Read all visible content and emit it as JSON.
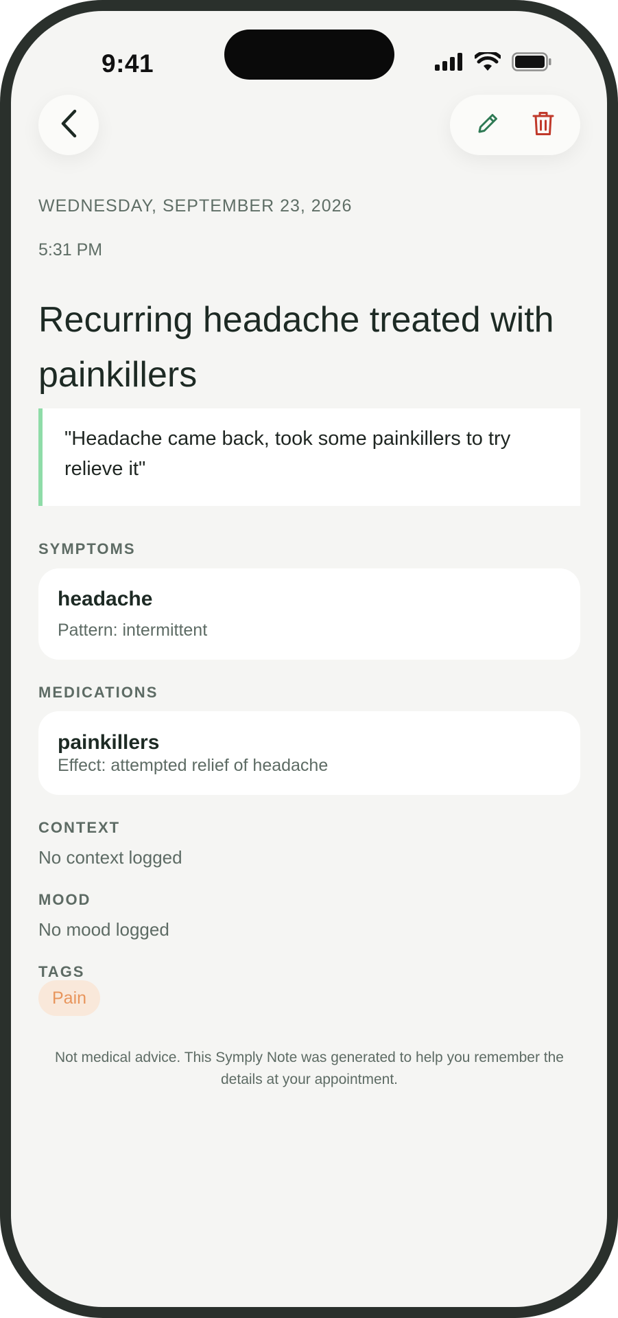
{
  "status_bar": {
    "time": "9:41"
  },
  "colors": {
    "accent_green": "#8fdca8",
    "edit_icon": "#2f7a55",
    "delete_icon": "#c0392b",
    "tag_bg": "#f9e8da",
    "tag_text": "#e8955c"
  },
  "header": {
    "back_icon": "chevron-left-icon",
    "edit_icon": "pencil-icon",
    "delete_icon": "trash-icon"
  },
  "entry": {
    "date": "WEDNESDAY, SEPTEMBER 23, 2026",
    "time": "5:31 PM",
    "title": "Recurring headache treated with painkillers",
    "quote": "\"Headache came back, took some painkillers to try relieve it\""
  },
  "symptoms": {
    "label": "SYMPTOMS",
    "items": [
      {
        "name": "headache",
        "detail": "Pattern: intermittent"
      }
    ]
  },
  "medications": {
    "label": "MEDICATIONS",
    "items": [
      {
        "name": "painkillers",
        "detail": "Effect: attempted relief of headache"
      }
    ]
  },
  "context": {
    "label": "CONTEXT",
    "value": "No context logged"
  },
  "mood": {
    "label": "MOOD",
    "value": "No mood logged"
  },
  "tags": {
    "label": "TAGS",
    "items": [
      "Pain"
    ]
  },
  "disclaimer": "Not medical advice. This Symply Note was generated to help you remember the details at your appointment."
}
